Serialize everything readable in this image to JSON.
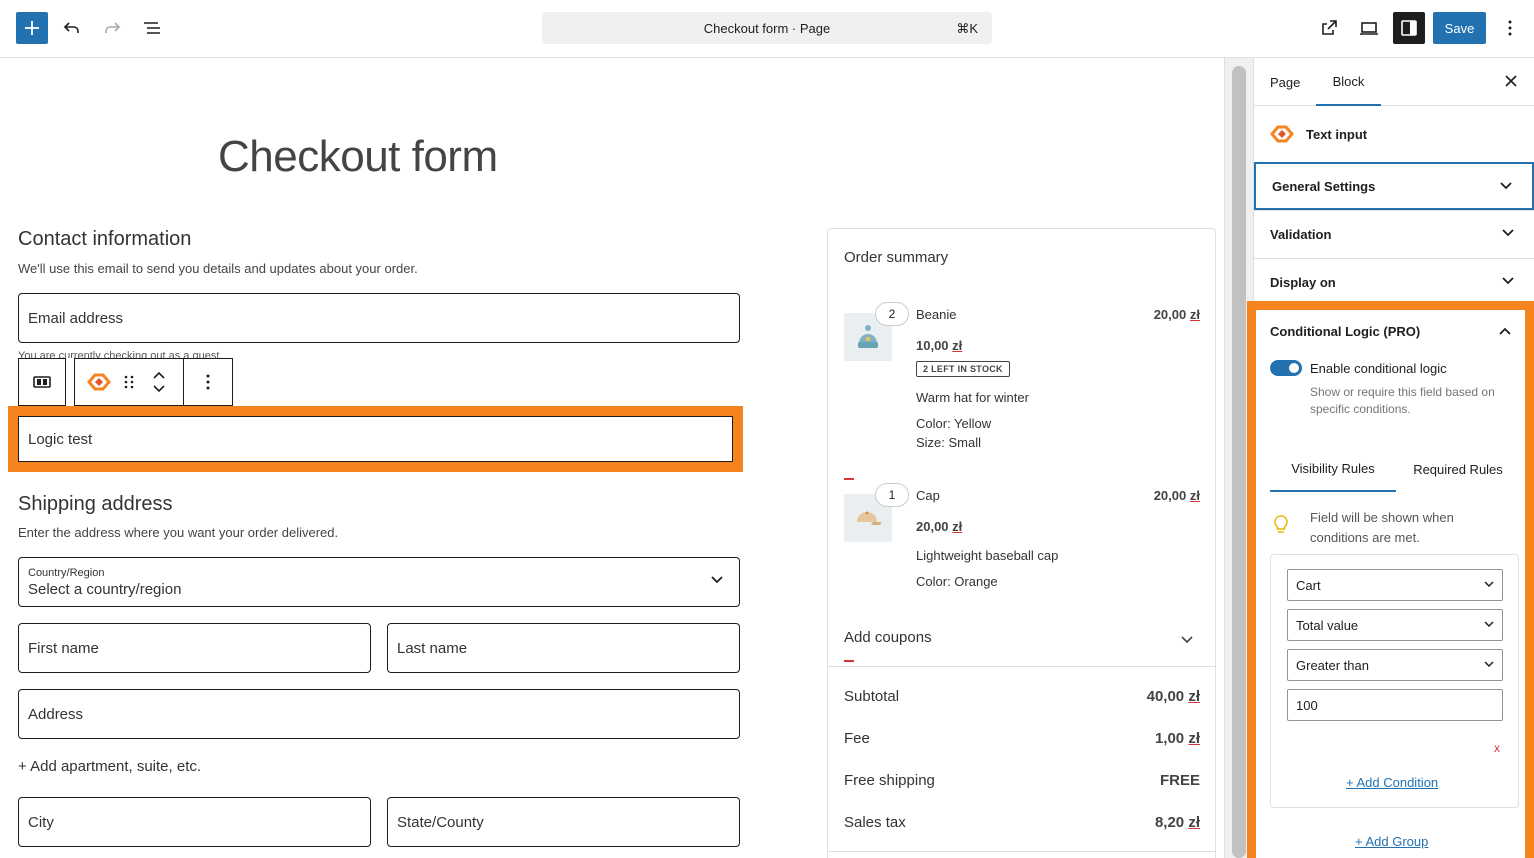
{
  "toolbar": {
    "document_title": "Checkout form · Page",
    "shortcut": "⌘K",
    "save_label": "Save"
  },
  "page": {
    "title": "Checkout form"
  },
  "contact": {
    "heading": "Contact information",
    "description": "We'll use this email to send you details and updates about your order.",
    "email_placeholder": "Email address",
    "guest_note": "You are currently checking out as a guest."
  },
  "logic_field": {
    "label": "Logic test"
  },
  "shipping": {
    "heading": "Shipping address",
    "description": "Enter the address where you want your order delivered.",
    "country_label": "Country/Region",
    "country_value": "Select a country/region",
    "first_name": "First name",
    "last_name": "Last name",
    "address": "Address",
    "add_apartment": "+ Add apartment, suite, etc.",
    "city": "City",
    "state": "State/County"
  },
  "order_summary": {
    "title": "Order summary",
    "items": [
      {
        "qty": "2",
        "name": "Beanie",
        "total_num": "20,00",
        "unit_num": "10,00",
        "stock": "2 LEFT IN STOCK",
        "desc": "Warm hat for winter",
        "attr1": "Color: Yellow",
        "attr2": "Size: Small"
      },
      {
        "qty": "1",
        "name": "Cap",
        "total_num": "20,00",
        "unit_num": "20,00",
        "desc": "Lightweight baseball cap",
        "attr1": "Color: Orange"
      }
    ],
    "currency": "zł",
    "add_coupons": "Add coupons",
    "subtotal_label": "Subtotal",
    "subtotal_num": "40,00",
    "fee_label": "Fee",
    "fee_num": "1,00",
    "shipping_label": "Free shipping",
    "shipping_value": "FREE",
    "tax_label": "Sales tax",
    "tax_num": "8,20"
  },
  "sidebar": {
    "tab_page": "Page",
    "tab_block": "Block",
    "block_name": "Text input",
    "panels": [
      "General Settings",
      "Validation",
      "Display on"
    ],
    "conditional": {
      "title": "Conditional Logic (PRO)",
      "toggle_label": "Enable conditional logic",
      "toggle_help": "Show or require this field based on specific conditions.",
      "tab_visibility": "Visibility Rules",
      "tab_required": "Required Rules",
      "notice": "Field will be shown when conditions are met.",
      "rule_source": "Cart",
      "rule_property": "Total value",
      "rule_operator": "Greater than",
      "rule_value": "100",
      "remove": "x",
      "add_condition": "+ Add Condition",
      "add_group": "+ Add Group"
    }
  },
  "colors": {
    "accent": "#2271b1",
    "highlight": "#f5841f",
    "error": "#d63638"
  }
}
